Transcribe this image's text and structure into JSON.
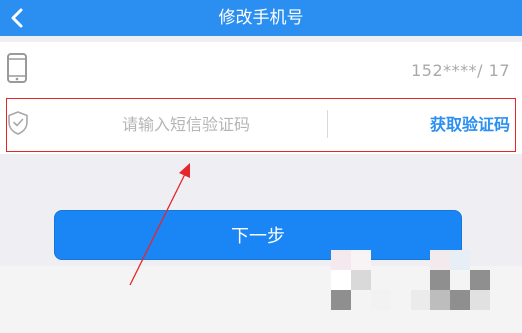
{
  "header": {
    "title": "修改手机号",
    "back_icon": "chevron-left-icon"
  },
  "phone": {
    "icon": "phone-icon",
    "number": "152****/  17"
  },
  "verification": {
    "icon": "shield-check-icon",
    "placeholder": "请输入短信验证码",
    "value": "",
    "get_code_label": "获取验证码"
  },
  "next_button": {
    "label": "下一步"
  },
  "colors": {
    "primary": "#2a8ff1",
    "button": "#1a85f5",
    "annotation": "#e5262a",
    "background": "#eeeef3"
  }
}
